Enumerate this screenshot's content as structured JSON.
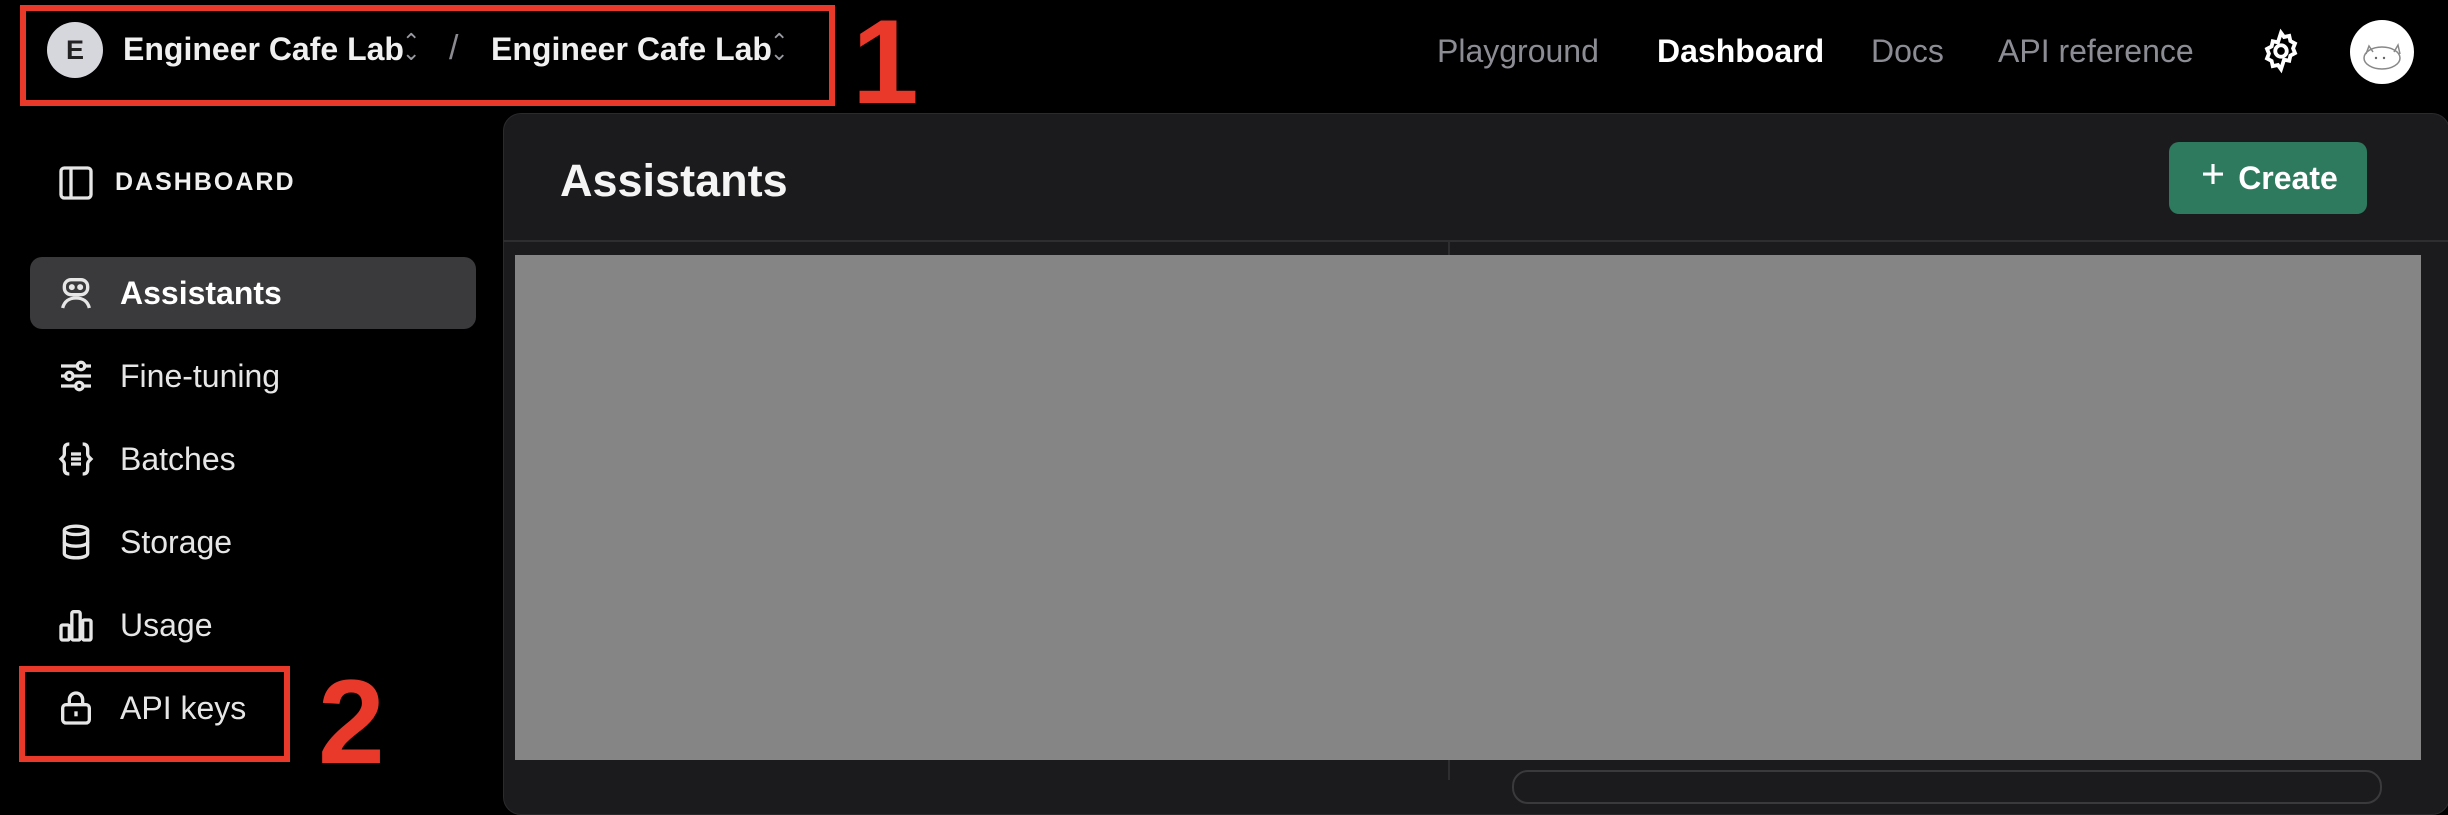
{
  "topbar": {
    "org_initial": "E",
    "org_name": "Engineer Cafe Lab",
    "separator": "/",
    "project_name": "Engineer Cafe Lab",
    "nav": {
      "playground": "Playground",
      "dashboard": "Dashboard",
      "docs": "Docs",
      "api_reference": "API reference"
    },
    "settings_icon": "gear-icon",
    "avatar_icon": "cat-avatar"
  },
  "sidebar": {
    "heading": "DASHBOARD",
    "heading_icon": "sidebar-panel-icon",
    "items": [
      {
        "label": "Assistants",
        "icon": "robot-icon",
        "active": true
      },
      {
        "label": "Fine-tuning",
        "icon": "sliders-icon",
        "active": false
      },
      {
        "label": "Batches",
        "icon": "braces-icon",
        "active": false
      },
      {
        "label": "Storage",
        "icon": "database-icon",
        "active": false
      },
      {
        "label": "Usage",
        "icon": "bar-chart-icon",
        "active": false
      },
      {
        "label": "API keys",
        "icon": "lock-icon",
        "active": false
      }
    ]
  },
  "main": {
    "title": "Assistants",
    "create_button": "Create",
    "create_icon": "plus-icon"
  },
  "annotations": {
    "label_1": "1",
    "label_2": "2"
  },
  "colors": {
    "background": "#000000",
    "panel": "#1b1b1d",
    "active_item": "#3a3a3d",
    "create_button": "#2e7a5f",
    "annotation": "#e8392a",
    "redacted_block": "#858585"
  }
}
